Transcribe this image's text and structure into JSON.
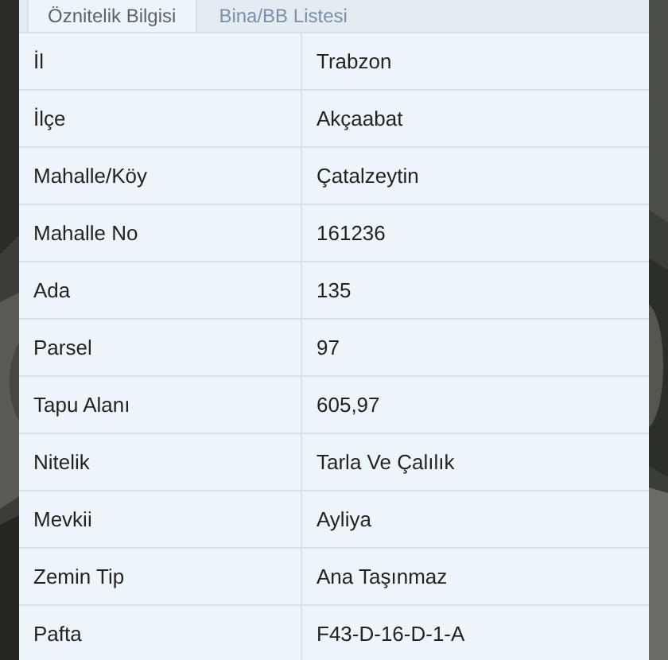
{
  "tabs": [
    {
      "label": "Öznitelik Bilgisi",
      "selected": true
    },
    {
      "label": "Bina/BB Listesi",
      "selected": false
    }
  ],
  "rows": [
    {
      "label": "İl",
      "value": "Trabzon"
    },
    {
      "label": "İlçe",
      "value": "Akçaabat"
    },
    {
      "label": "Mahalle/Köy",
      "value": "Çatalzeytin"
    },
    {
      "label": "Mahalle No",
      "value": "161236"
    },
    {
      "label": "Ada",
      "value": "135"
    },
    {
      "label": "Parsel",
      "value": "97"
    },
    {
      "label": "Tapu Alanı",
      "value": "605,97"
    },
    {
      "label": "Nitelik",
      "value": "Tarla Ve Çalılık"
    },
    {
      "label": "Mevkii",
      "value": "Ayliya"
    },
    {
      "label": "Zemin Tip",
      "value": "Ana Taşınmaz"
    },
    {
      "label": "Pafta",
      "value": "F43-D-16-D-1-A"
    }
  ]
}
